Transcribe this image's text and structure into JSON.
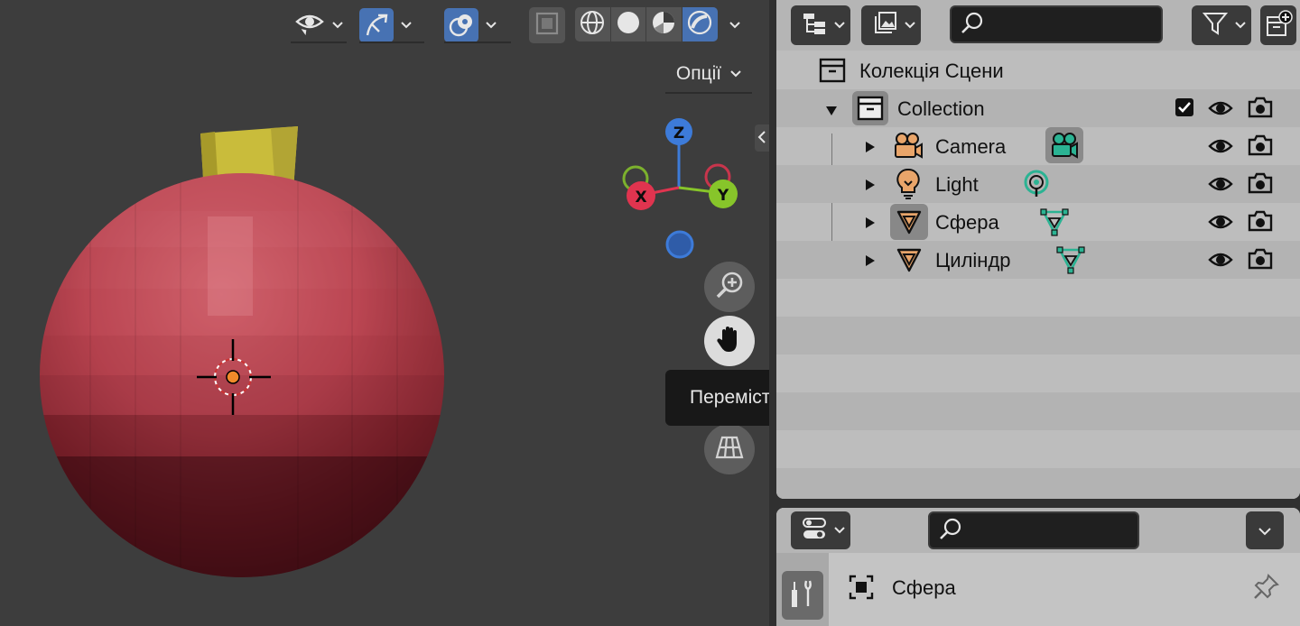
{
  "viewport": {
    "options_label": "Опції",
    "tooltip_text": "Перемістити перегляд",
    "gizmo": {
      "z_label": "Z",
      "x_label": "X",
      "y_label": "Y"
    },
    "colors": {
      "axis_x": "#e0344f",
      "axis_y": "#87c52a",
      "axis_z": "#3d7bd9",
      "sphere": "#b94a55",
      "cylinder": "#c9bc3b",
      "active_blue": "#4772b3"
    }
  },
  "outliner": {
    "scene_collection_label": "Колекція Сцени",
    "rows": [
      {
        "label": "Collection"
      },
      {
        "label": "Camera"
      },
      {
        "label": "Light"
      },
      {
        "label": "Сфера"
      },
      {
        "label": "Циліндр"
      }
    ]
  },
  "properties": {
    "object_name": "Сфера"
  }
}
